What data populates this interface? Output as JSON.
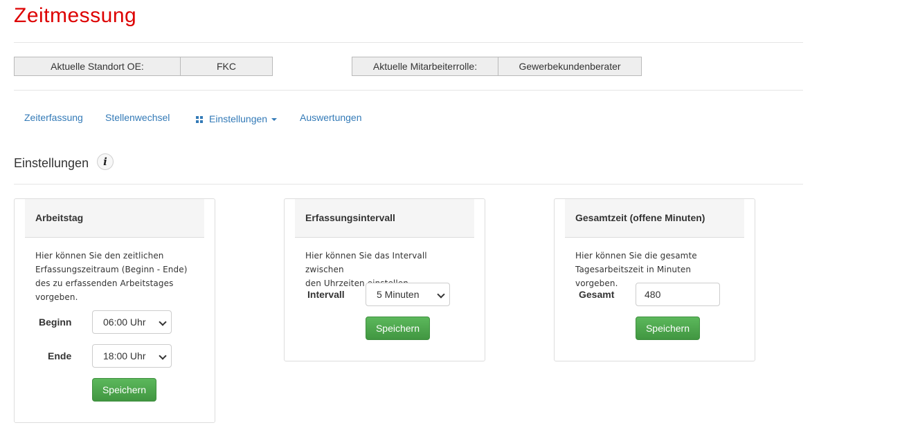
{
  "page": {
    "title": "Zeitmessung"
  },
  "context": {
    "standort_label": "Aktuelle Standort OE:",
    "standort_value": "FKC",
    "rolle_label": "Aktuelle Mitarbeiterrolle:",
    "rolle_value": "Gewerbekundenberater"
  },
  "nav": {
    "items": [
      {
        "label": "Zeiterfassung"
      },
      {
        "label": "Stellenwechsel"
      },
      {
        "label": "Einstellungen",
        "icon": "grid-icon",
        "dropdown": true
      },
      {
        "label": "Auswertungen"
      }
    ]
  },
  "section": {
    "title": "Einstellungen",
    "info_icon": "i"
  },
  "panels": {
    "arbeitstag": {
      "title": "Arbeitstag",
      "description_lines": [
        "Hier können Sie den zeitlichen",
        "Erfassungszeitraum (Beginn - Ende)",
        "des zu erfassenden Arbeitstages",
        "vorgeben."
      ],
      "beginn_label": "Beginn",
      "beginn_value": "06:00 Uhr",
      "ende_label": "Ende",
      "ende_value": "18:00 Uhr",
      "save_label": "Speichern"
    },
    "intervall": {
      "title": "Erfassungsintervall",
      "description_lines": [
        "Hier können Sie das Intervall zwischen",
        "den Uhrzeiten einstellen."
      ],
      "intervall_label": "Intervall",
      "intervall_value": "5 Minuten",
      "save_label": "Speichern"
    },
    "gesamtzeit": {
      "title": "Gesamtzeit (offene Minuten)",
      "description_lines": [
        "Hier können Sie die gesamte",
        "Tagesarbeitszeit in Minuten vorgeben."
      ],
      "gesamt_label": "Gesamt",
      "gesamt_value": "480",
      "save_label": "Speichern"
    }
  },
  "colors": {
    "title": "#dd0000",
    "link": "#337ab7",
    "button": "#4cae4c"
  }
}
